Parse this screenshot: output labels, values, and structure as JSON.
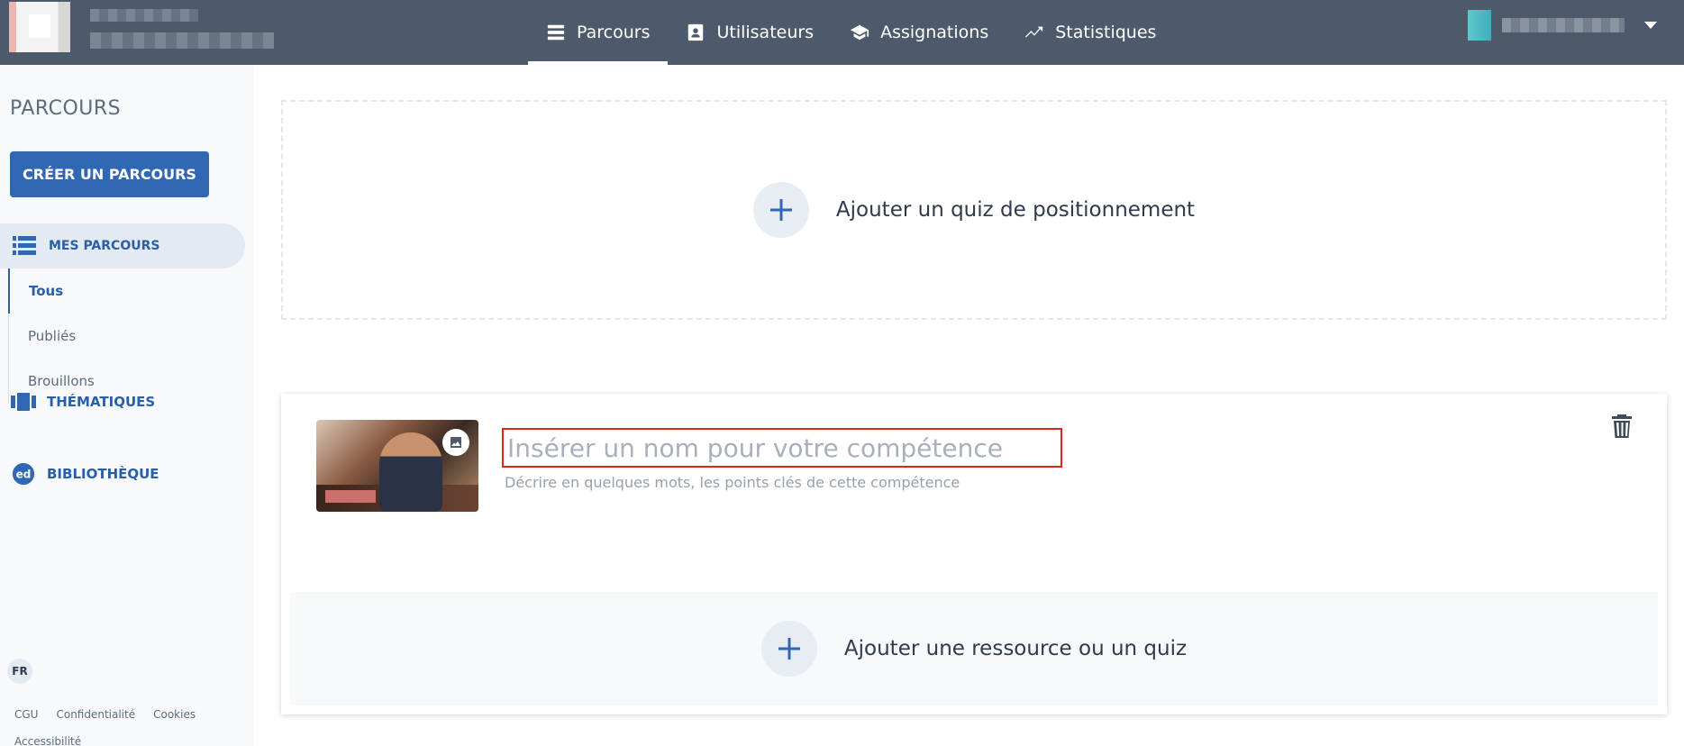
{
  "nav": {
    "items": [
      {
        "label": "Parcours",
        "icon": "list-icon",
        "active": true
      },
      {
        "label": "Utilisateurs",
        "icon": "contact-card-icon",
        "active": false
      },
      {
        "label": "Assignations",
        "icon": "graduation-cap-icon",
        "active": false
      },
      {
        "label": "Statistiques",
        "icon": "trending-line-icon",
        "active": false
      }
    ]
  },
  "sidebar": {
    "title": "PARCOURS",
    "create_button": "CRÉER UN PARCOURS",
    "mes_parcours": "MES PARCOURS",
    "submenu": [
      "Tous",
      "Publiés",
      "Brouillons"
    ],
    "thematiques": "THÉMATIQUES",
    "bibliotheque": "BIBLIOTHÈQUE",
    "lang": "FR",
    "footer": [
      "CGU",
      "Confidentialité",
      "Cookies",
      "Accessibilité"
    ]
  },
  "main": {
    "add_quiz_label": "Ajouter un quiz de positionnement",
    "competence": {
      "name_placeholder": "Insérer un nom pour votre compétence",
      "description_placeholder": "Décrire en quelques mots, les points clés de cette compétence",
      "add_resource_label": "Ajouter une ressource ou un quiz"
    }
  },
  "colors": {
    "topbar": "#4c5a6b",
    "accent": "#2f67b2",
    "highlight_border": "#e0241b"
  }
}
